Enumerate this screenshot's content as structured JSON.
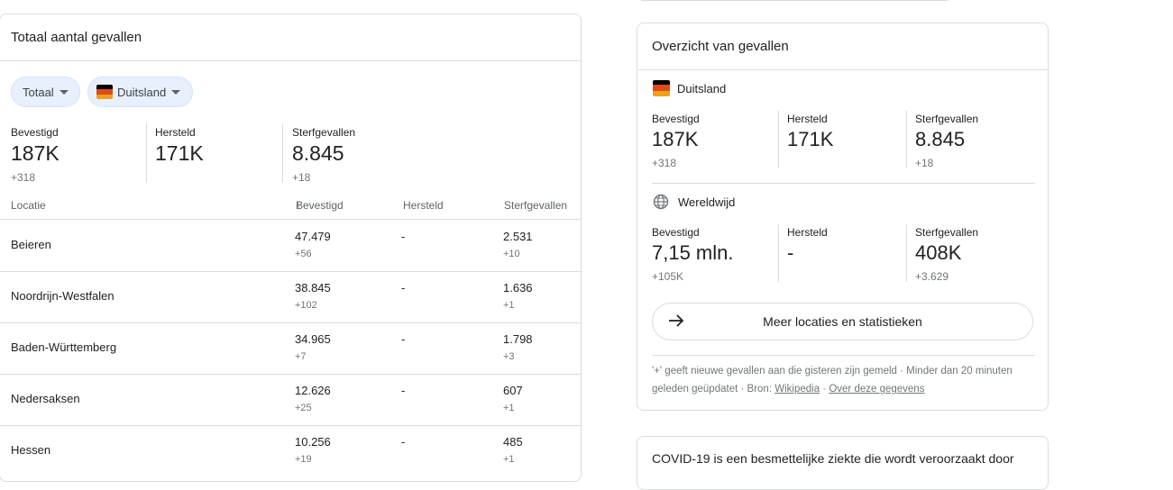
{
  "left_card": {
    "title": "Totaal aantal gevallen",
    "chips": {
      "filter": "Totaal",
      "country": "Duitsland"
    },
    "stats": [
      {
        "label": "Bevestigd",
        "value": "187K",
        "delta": "+318"
      },
      {
        "label": "Hersteld",
        "value": "171K",
        "delta": ""
      },
      {
        "label": "Sterfgevallen",
        "value": "8.845",
        "delta": "+18"
      }
    ],
    "table": {
      "headers": [
        "Locatie",
        "Bevestigd",
        "Hersteld",
        "Sterfgevallen"
      ],
      "sort_icon": "↓",
      "rows": [
        {
          "location": "Beieren",
          "confirmed": "47.479",
          "confirmed_delta": "+56",
          "recovered": "-",
          "deaths": "2.531",
          "deaths_delta": "+10"
        },
        {
          "location": "Noordrijn-Westfalen",
          "confirmed": "38.845",
          "confirmed_delta": "+102",
          "recovered": "-",
          "deaths": "1.636",
          "deaths_delta": "+1"
        },
        {
          "location": "Baden-Württemberg",
          "confirmed": "34.965",
          "confirmed_delta": "+7",
          "recovered": "-",
          "deaths": "1.798",
          "deaths_delta": "+3"
        },
        {
          "location": "Nedersaksen",
          "confirmed": "12.626",
          "confirmed_delta": "+25",
          "recovered": "-",
          "deaths": "607",
          "deaths_delta": "+1"
        },
        {
          "location": "Hessen",
          "confirmed": "10.256",
          "confirmed_delta": "+19",
          "recovered": "-",
          "deaths": "485",
          "deaths_delta": "+1"
        }
      ]
    }
  },
  "right_card": {
    "title": "Overzicht van gevallen",
    "germany": {
      "name": "Duitsland",
      "stats": [
        {
          "label": "Bevestigd",
          "value": "187K",
          "delta": "+318"
        },
        {
          "label": "Hersteld",
          "value": "171K",
          "delta": ""
        },
        {
          "label": "Sterfgevallen",
          "value": "8.845",
          "delta": "+18"
        }
      ]
    },
    "world": {
      "name": "Wereldwijd",
      "stats": [
        {
          "label": "Bevestigd",
          "value": "7,15 mln.",
          "delta": "+105K"
        },
        {
          "label": "Hersteld",
          "value": "-",
          "delta": ""
        },
        {
          "label": "Sterfgevallen",
          "value": "408K",
          "delta": "+3.629"
        }
      ]
    },
    "more_button": "Meer locaties en statistieken",
    "footer": {
      "text": "'+' geeft nieuwe gevallen aan die gisteren zijn gemeld · Minder dan 20 minuten geleden geüpdatet",
      "source_label": "Bron:",
      "source_link": "Wikipedia",
      "about_link": "Over deze gegevens"
    }
  },
  "bottom_card": {
    "text": "COVID-19 is een besmettelijke ziekte die wordt veroorzaakt door"
  },
  "colors": {
    "flag_black": "#000000",
    "flag_red": "#dd4b1a",
    "flag_gold": "#f29f1b",
    "chip_bg": "#e8f0fe"
  }
}
